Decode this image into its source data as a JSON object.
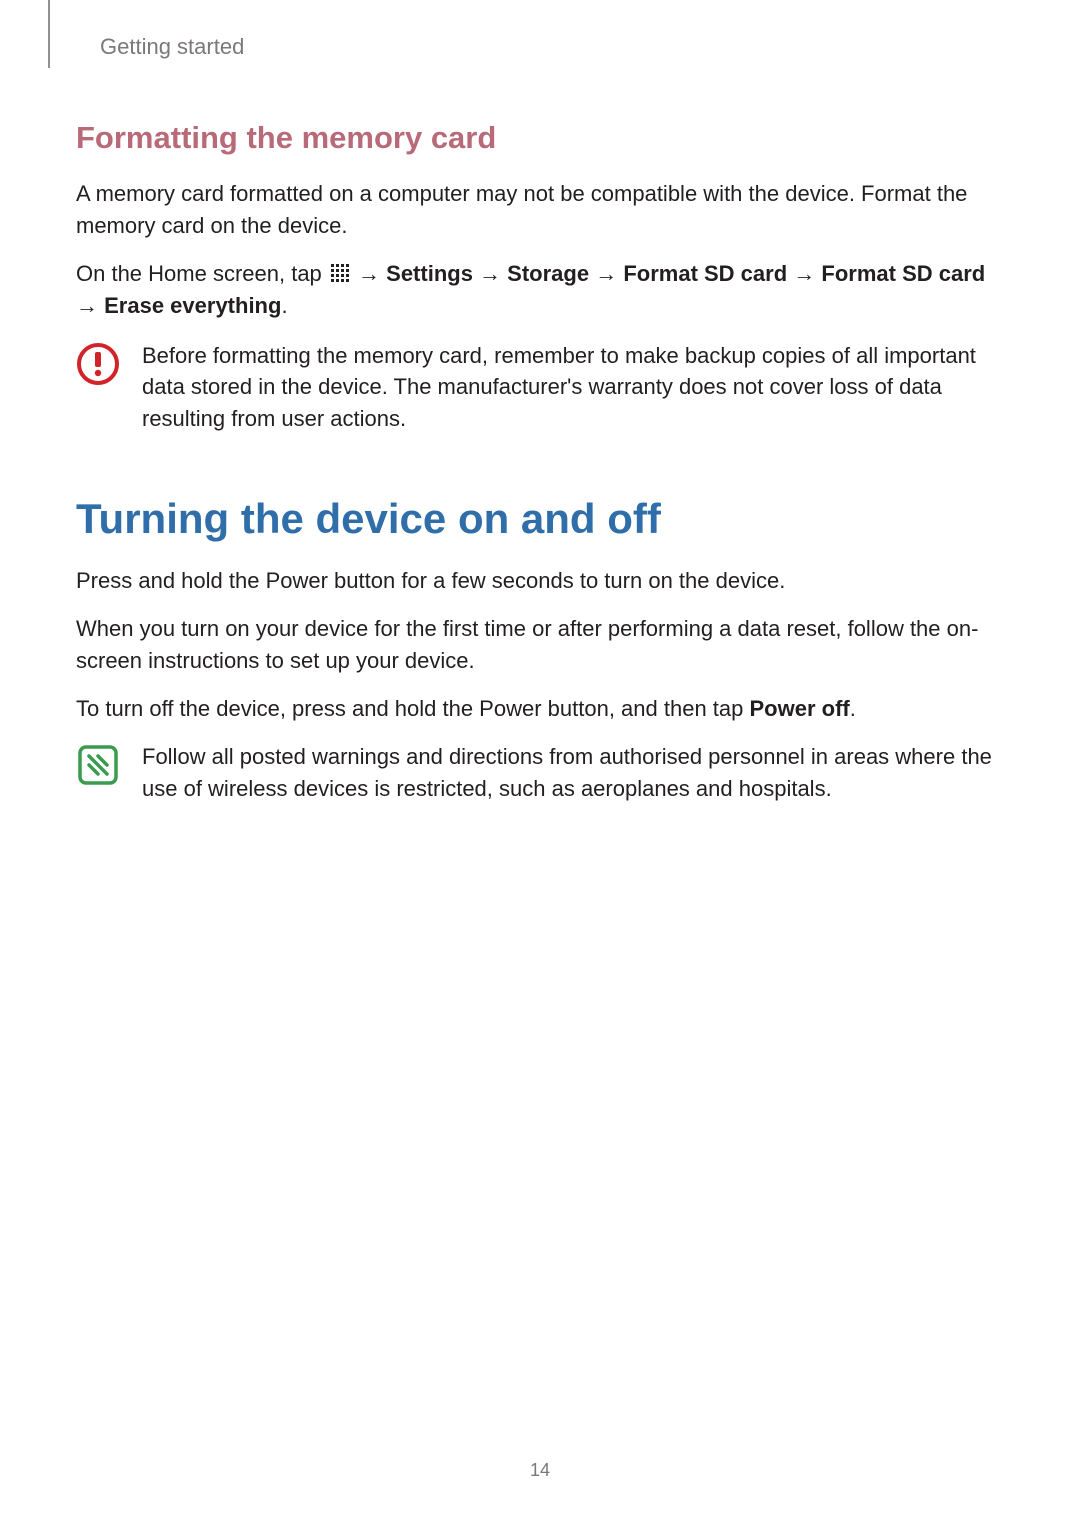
{
  "breadcrumb": "Getting started",
  "section1": {
    "heading": "Formatting the memory card",
    "p1": "A memory card formatted on a computer may not be compatible with the device. Format the memory card on the device.",
    "path_prefix": "On the Home screen, tap ",
    "arrow": " → ",
    "path_items": [
      "Settings",
      "Storage",
      "Format SD card",
      "Format SD card",
      "Erase everything"
    ],
    "path_suffix": ".",
    "warning": "Before formatting the memory card, remember to make backup copies of all important data stored in the device. The manufacturer's warranty does not cover loss of data resulting from user actions."
  },
  "section2": {
    "heading": "Turning the device on and off",
    "p1": "Press and hold the Power button for a few seconds to turn on the device.",
    "p2": "When you turn on your device for the first time or after performing a data reset, follow the on-screen instructions to set up your device.",
    "p3_pre": "To turn off the device, press and hold the Power button, and then tap ",
    "p3_bold": "Power off",
    "p3_post": ".",
    "note": "Follow all posted warnings and directions from authorised personnel in areas where the use of wireless devices is restricted, such as aeroplanes and hospitals."
  },
  "page_number": "14"
}
